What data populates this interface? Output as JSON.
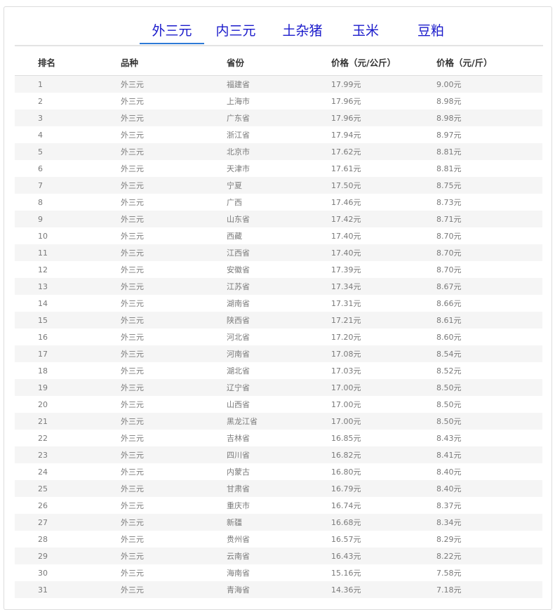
{
  "tabs": [
    {
      "label": "外三元",
      "active": true
    },
    {
      "label": "内三元",
      "active": false
    },
    {
      "label": "土杂猪",
      "active": false
    },
    {
      "label": "玉米",
      "active": false
    },
    {
      "label": "豆粕",
      "active": false
    }
  ],
  "table": {
    "headers": [
      "排名",
      "品种",
      "省份",
      "价格（元/公斤）",
      "价格（元/斤）"
    ],
    "rows": [
      [
        "1",
        "外三元",
        "福建省",
        "17.99元",
        "9.00元"
      ],
      [
        "2",
        "外三元",
        "上海市",
        "17.96元",
        "8.98元"
      ],
      [
        "3",
        "外三元",
        "广东省",
        "17.96元",
        "8.98元"
      ],
      [
        "4",
        "外三元",
        "浙江省",
        "17.94元",
        "8.97元"
      ],
      [
        "5",
        "外三元",
        "北京市",
        "17.62元",
        "8.81元"
      ],
      [
        "6",
        "外三元",
        "天津市",
        "17.61元",
        "8.81元"
      ],
      [
        "7",
        "外三元",
        "宁夏",
        "17.50元",
        "8.75元"
      ],
      [
        "8",
        "外三元",
        "广西",
        "17.46元",
        "8.73元"
      ],
      [
        "9",
        "外三元",
        "山东省",
        "17.42元",
        "8.71元"
      ],
      [
        "10",
        "外三元",
        "西藏",
        "17.40元",
        "8.70元"
      ],
      [
        "11",
        "外三元",
        "江西省",
        "17.40元",
        "8.70元"
      ],
      [
        "12",
        "外三元",
        "安徽省",
        "17.39元",
        "8.70元"
      ],
      [
        "13",
        "外三元",
        "江苏省",
        "17.34元",
        "8.67元"
      ],
      [
        "14",
        "外三元",
        "湖南省",
        "17.31元",
        "8.66元"
      ],
      [
        "15",
        "外三元",
        "陕西省",
        "17.21元",
        "8.61元"
      ],
      [
        "16",
        "外三元",
        "河北省",
        "17.20元",
        "8.60元"
      ],
      [
        "17",
        "外三元",
        "河南省",
        "17.08元",
        "8.54元"
      ],
      [
        "18",
        "外三元",
        "湖北省",
        "17.03元",
        "8.52元"
      ],
      [
        "19",
        "外三元",
        "辽宁省",
        "17.00元",
        "8.50元"
      ],
      [
        "20",
        "外三元",
        "山西省",
        "17.00元",
        "8.50元"
      ],
      [
        "21",
        "外三元",
        "黑龙江省",
        "17.00元",
        "8.50元"
      ],
      [
        "22",
        "外三元",
        "吉林省",
        "16.85元",
        "8.43元"
      ],
      [
        "23",
        "外三元",
        "四川省",
        "16.82元",
        "8.41元"
      ],
      [
        "24",
        "外三元",
        "内蒙古",
        "16.80元",
        "8.40元"
      ],
      [
        "25",
        "外三元",
        "甘肃省",
        "16.79元",
        "8.40元"
      ],
      [
        "26",
        "外三元",
        "重庆市",
        "16.74元",
        "8.37元"
      ],
      [
        "27",
        "外三元",
        "新疆",
        "16.68元",
        "8.34元"
      ],
      [
        "28",
        "外三元",
        "贵州省",
        "16.57元",
        "8.29元"
      ],
      [
        "29",
        "外三元",
        "云南省",
        "16.43元",
        "8.22元"
      ],
      [
        "30",
        "外三元",
        "海南省",
        "15.16元",
        "7.58元"
      ],
      [
        "31",
        "外三元",
        "青海省",
        "14.36元",
        "7.18元"
      ]
    ]
  }
}
